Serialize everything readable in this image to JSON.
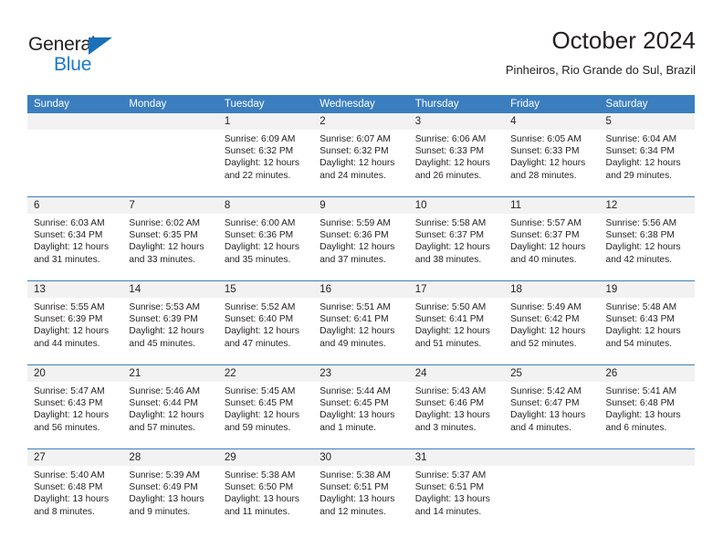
{
  "brand": {
    "name_part1": "General",
    "name_part2": "Blue",
    "triangle_color": "#1a70b8",
    "blue_color": "#1a7ac8"
  },
  "header": {
    "title": "October 2024",
    "subtitle": "Pinheiros, Rio Grande do Sul, Brazil"
  },
  "theme": {
    "header_bar_color": "#3b7ebf",
    "daynum_band_color": "#f2f2f2",
    "text_color": "#231f20"
  },
  "weekday_headers": [
    "Sunday",
    "Monday",
    "Tuesday",
    "Wednesday",
    "Thursday",
    "Friday",
    "Saturday"
  ],
  "weeks": [
    [
      {
        "day": "",
        "sunrise": "",
        "sunset": "",
        "daylight": ""
      },
      {
        "day": "",
        "sunrise": "",
        "sunset": "",
        "daylight": ""
      },
      {
        "day": "1",
        "sunrise": "Sunrise: 6:09 AM",
        "sunset": "Sunset: 6:32 PM",
        "daylight": "Daylight: 12 hours and 22 minutes."
      },
      {
        "day": "2",
        "sunrise": "Sunrise: 6:07 AM",
        "sunset": "Sunset: 6:32 PM",
        "daylight": "Daylight: 12 hours and 24 minutes."
      },
      {
        "day": "3",
        "sunrise": "Sunrise: 6:06 AM",
        "sunset": "Sunset: 6:33 PM",
        "daylight": "Daylight: 12 hours and 26 minutes."
      },
      {
        "day": "4",
        "sunrise": "Sunrise: 6:05 AM",
        "sunset": "Sunset: 6:33 PM",
        "daylight": "Daylight: 12 hours and 28 minutes."
      },
      {
        "day": "5",
        "sunrise": "Sunrise: 6:04 AM",
        "sunset": "Sunset: 6:34 PM",
        "daylight": "Daylight: 12 hours and 29 minutes."
      }
    ],
    [
      {
        "day": "6",
        "sunrise": "Sunrise: 6:03 AM",
        "sunset": "Sunset: 6:34 PM",
        "daylight": "Daylight: 12 hours and 31 minutes."
      },
      {
        "day": "7",
        "sunrise": "Sunrise: 6:02 AM",
        "sunset": "Sunset: 6:35 PM",
        "daylight": "Daylight: 12 hours and 33 minutes."
      },
      {
        "day": "8",
        "sunrise": "Sunrise: 6:00 AM",
        "sunset": "Sunset: 6:36 PM",
        "daylight": "Daylight: 12 hours and 35 minutes."
      },
      {
        "day": "9",
        "sunrise": "Sunrise: 5:59 AM",
        "sunset": "Sunset: 6:36 PM",
        "daylight": "Daylight: 12 hours and 37 minutes."
      },
      {
        "day": "10",
        "sunrise": "Sunrise: 5:58 AM",
        "sunset": "Sunset: 6:37 PM",
        "daylight": "Daylight: 12 hours and 38 minutes."
      },
      {
        "day": "11",
        "sunrise": "Sunrise: 5:57 AM",
        "sunset": "Sunset: 6:37 PM",
        "daylight": "Daylight: 12 hours and 40 minutes."
      },
      {
        "day": "12",
        "sunrise": "Sunrise: 5:56 AM",
        "sunset": "Sunset: 6:38 PM",
        "daylight": "Daylight: 12 hours and 42 minutes."
      }
    ],
    [
      {
        "day": "13",
        "sunrise": "Sunrise: 5:55 AM",
        "sunset": "Sunset: 6:39 PM",
        "daylight": "Daylight: 12 hours and 44 minutes."
      },
      {
        "day": "14",
        "sunrise": "Sunrise: 5:53 AM",
        "sunset": "Sunset: 6:39 PM",
        "daylight": "Daylight: 12 hours and 45 minutes."
      },
      {
        "day": "15",
        "sunrise": "Sunrise: 5:52 AM",
        "sunset": "Sunset: 6:40 PM",
        "daylight": "Daylight: 12 hours and 47 minutes."
      },
      {
        "day": "16",
        "sunrise": "Sunrise: 5:51 AM",
        "sunset": "Sunset: 6:41 PM",
        "daylight": "Daylight: 12 hours and 49 minutes."
      },
      {
        "day": "17",
        "sunrise": "Sunrise: 5:50 AM",
        "sunset": "Sunset: 6:41 PM",
        "daylight": "Daylight: 12 hours and 51 minutes."
      },
      {
        "day": "18",
        "sunrise": "Sunrise: 5:49 AM",
        "sunset": "Sunset: 6:42 PM",
        "daylight": "Daylight: 12 hours and 52 minutes."
      },
      {
        "day": "19",
        "sunrise": "Sunrise: 5:48 AM",
        "sunset": "Sunset: 6:43 PM",
        "daylight": "Daylight: 12 hours and 54 minutes."
      }
    ],
    [
      {
        "day": "20",
        "sunrise": "Sunrise: 5:47 AM",
        "sunset": "Sunset: 6:43 PM",
        "daylight": "Daylight: 12 hours and 56 minutes."
      },
      {
        "day": "21",
        "sunrise": "Sunrise: 5:46 AM",
        "sunset": "Sunset: 6:44 PM",
        "daylight": "Daylight: 12 hours and 57 minutes."
      },
      {
        "day": "22",
        "sunrise": "Sunrise: 5:45 AM",
        "sunset": "Sunset: 6:45 PM",
        "daylight": "Daylight: 12 hours and 59 minutes."
      },
      {
        "day": "23",
        "sunrise": "Sunrise: 5:44 AM",
        "sunset": "Sunset: 6:45 PM",
        "daylight": "Daylight: 13 hours and 1 minute."
      },
      {
        "day": "24",
        "sunrise": "Sunrise: 5:43 AM",
        "sunset": "Sunset: 6:46 PM",
        "daylight": "Daylight: 13 hours and 3 minutes."
      },
      {
        "day": "25",
        "sunrise": "Sunrise: 5:42 AM",
        "sunset": "Sunset: 6:47 PM",
        "daylight": "Daylight: 13 hours and 4 minutes."
      },
      {
        "day": "26",
        "sunrise": "Sunrise: 5:41 AM",
        "sunset": "Sunset: 6:48 PM",
        "daylight": "Daylight: 13 hours and 6 minutes."
      }
    ],
    [
      {
        "day": "27",
        "sunrise": "Sunrise: 5:40 AM",
        "sunset": "Sunset: 6:48 PM",
        "daylight": "Daylight: 13 hours and 8 minutes."
      },
      {
        "day": "28",
        "sunrise": "Sunrise: 5:39 AM",
        "sunset": "Sunset: 6:49 PM",
        "daylight": "Daylight: 13 hours and 9 minutes."
      },
      {
        "day": "29",
        "sunrise": "Sunrise: 5:38 AM",
        "sunset": "Sunset: 6:50 PM",
        "daylight": "Daylight: 13 hours and 11 minutes."
      },
      {
        "day": "30",
        "sunrise": "Sunrise: 5:38 AM",
        "sunset": "Sunset: 6:51 PM",
        "daylight": "Daylight: 13 hours and 12 minutes."
      },
      {
        "day": "31",
        "sunrise": "Sunrise: 5:37 AM",
        "sunset": "Sunset: 6:51 PM",
        "daylight": "Daylight: 13 hours and 14 minutes."
      },
      {
        "day": "",
        "sunrise": "",
        "sunset": "",
        "daylight": ""
      },
      {
        "day": "",
        "sunrise": "",
        "sunset": "",
        "daylight": ""
      }
    ]
  ]
}
